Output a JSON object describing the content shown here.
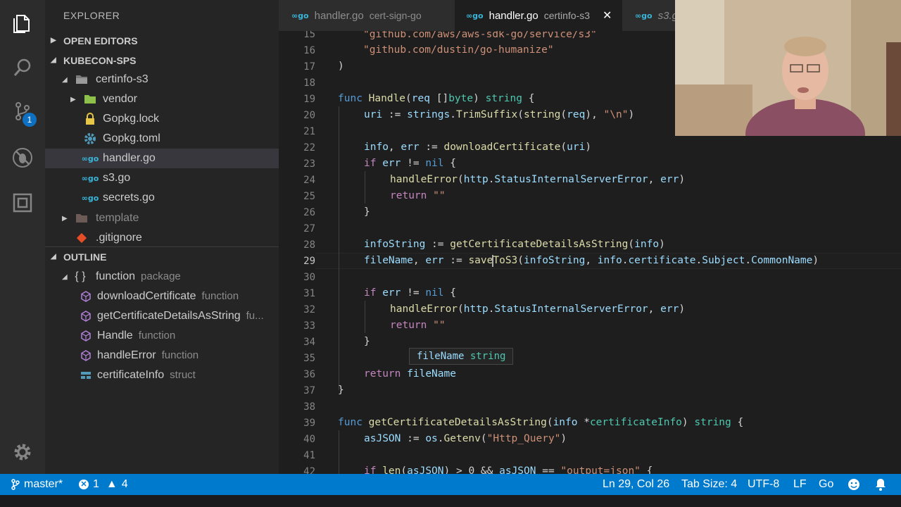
{
  "sidebar": {
    "explorer_title": "EXPLORER",
    "open_editors": "OPEN EDITORS",
    "project": "KUBECON-SPS",
    "tree": [
      {
        "label": "certinfo-s3",
        "kind": "folder-open"
      },
      {
        "label": "vendor",
        "kind": "folder"
      },
      {
        "label": "Gopkg.lock",
        "kind": "lock"
      },
      {
        "label": "Gopkg.toml",
        "kind": "gear"
      },
      {
        "label": "handler.go",
        "kind": "go"
      },
      {
        "label": "s3.go",
        "kind": "go"
      },
      {
        "label": "secrets.go",
        "kind": "go"
      },
      {
        "label": "template",
        "kind": "folder"
      },
      {
        "label": ".gitignore",
        "kind": "git"
      }
    ],
    "outline_title": "OUTLINE",
    "outline": [
      {
        "label": "function",
        "desc": "package",
        "kind": "braces"
      },
      {
        "label": "downloadCertificate",
        "desc": "function",
        "kind": "method"
      },
      {
        "label": "getCertificateDetailsAsString",
        "desc": "fu...",
        "kind": "method"
      },
      {
        "label": "Handle",
        "desc": "function",
        "kind": "method"
      },
      {
        "label": "handleError",
        "desc": "function",
        "kind": "method"
      },
      {
        "label": "certificateInfo",
        "desc": "struct",
        "kind": "struct"
      }
    ],
    "scm_badge": "1"
  },
  "tabs": [
    {
      "label": "handler.go",
      "desc": "cert-sign-go",
      "active": false
    },
    {
      "label": "handler.go",
      "desc": "certinfo-s3",
      "active": true,
      "close": "✕"
    },
    {
      "label": "s3.g",
      "desc": "",
      "active": false
    }
  ],
  "editor": {
    "current_line": 29,
    "line_numbers": [
      "15",
      "16",
      "17",
      "18",
      "19",
      "20",
      "21",
      "22",
      "23",
      "24",
      "25",
      "26",
      "27",
      "28",
      "29",
      "30",
      "31",
      "32",
      "33",
      "34",
      "35",
      "36",
      "37",
      "38",
      "39",
      "40",
      "41",
      "42"
    ],
    "hover_text": "fileName string"
  },
  "status": {
    "branch": "master*",
    "errors": "1",
    "warnings": "4",
    "position": "Ln 29, Col 26",
    "tab_size": "Tab Size: 4",
    "encoding": "UTF-8",
    "eol": "LF",
    "language": "Go"
  },
  "colors": {
    "status_bar": "#007acc",
    "sidebar": "#252526",
    "editor": "#1e1e1e",
    "activity_bar": "#2c2c2c"
  }
}
